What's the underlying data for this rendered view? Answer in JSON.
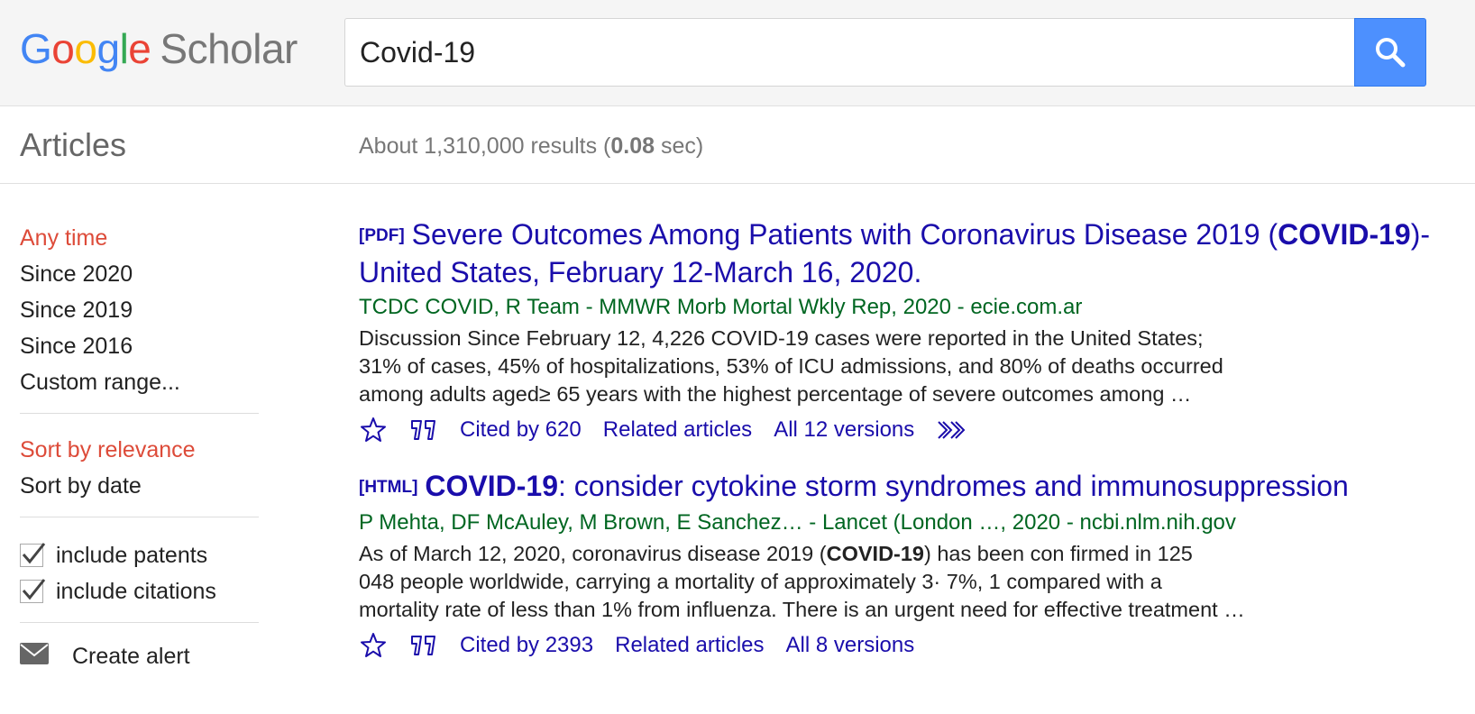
{
  "header": {
    "logo_letters": [
      "G",
      "o",
      "o",
      "g",
      "l",
      "e"
    ],
    "logo_product": "Scholar",
    "search_value": "Covid-19"
  },
  "subbar": {
    "section_label": "Articles",
    "results_prefix": "About 1,310,000 results (",
    "results_time": "0.08",
    "results_suffix": " sec)"
  },
  "sidebar": {
    "time_filters": [
      "Any time",
      "Since 2020",
      "Since 2019",
      "Since 2016",
      "Custom range..."
    ],
    "sort_options": [
      "Sort by relevance",
      "Sort by date"
    ],
    "checkboxes": [
      "include patents",
      "include citations"
    ],
    "create_alert": "Create alert"
  },
  "results": [
    {
      "type_tag": "[PDF]",
      "title_pre": "Severe Outcomes Among Patients with Coronavirus Disease 2019 (",
      "title_bold": "COVID-19",
      "title_post": ")-United States, February 12-March 16, 2020.",
      "meta": "TCDC COVID, R Team - MMWR Morb Mortal Wkly Rep, 2020 - ecie.com.ar",
      "snippet_lines": [
        "Discussion Since February 12, 4,226 COVID-19 cases were reported in the United States;",
        "31% of cases, 45% of hospitalizations, 53% of ICU admissions, and 80% of deaths occurred",
        "among adults aged≥ 65 years with the highest percentage of severe outcomes among …"
      ],
      "cited_by": "Cited by 620",
      "related": "Related articles",
      "versions": "All 12 versions"
    },
    {
      "type_tag": "[HTML]",
      "title_bold": "COVID-19",
      "title_post": ": consider cytokine storm syndromes and immunosuppression",
      "meta": "P Mehta, DF McAuley, M Brown, E Sanchez… - Lancet (London …, 2020 - ncbi.nlm.nih.gov",
      "snippet_line1_pre": "As of March 12, 2020, coronavirus disease 2019 (",
      "snippet_line1_bold": "COVID-19",
      "snippet_line1_post": ") has been con firmed in 125",
      "snippet_lines_rest": [
        "048 people worldwide, carrying a mortality of approximately 3· 7%, 1 compared with a",
        "mortality rate of less than 1% from influenza. There is an urgent need for effective treatment …"
      ],
      "cited_by": "Cited by 2393",
      "related": "Related articles",
      "versions": "All 8 versions"
    }
  ],
  "colors": {
    "link": "#1a0dab",
    "meta_green": "#006621",
    "selected_red": "#dd4b39",
    "search_button": "#4d90fe"
  },
  "icons": [
    "search-icon",
    "star-icon",
    "quote-icon",
    "more-icon",
    "checkmark-icon",
    "mail-icon"
  ]
}
